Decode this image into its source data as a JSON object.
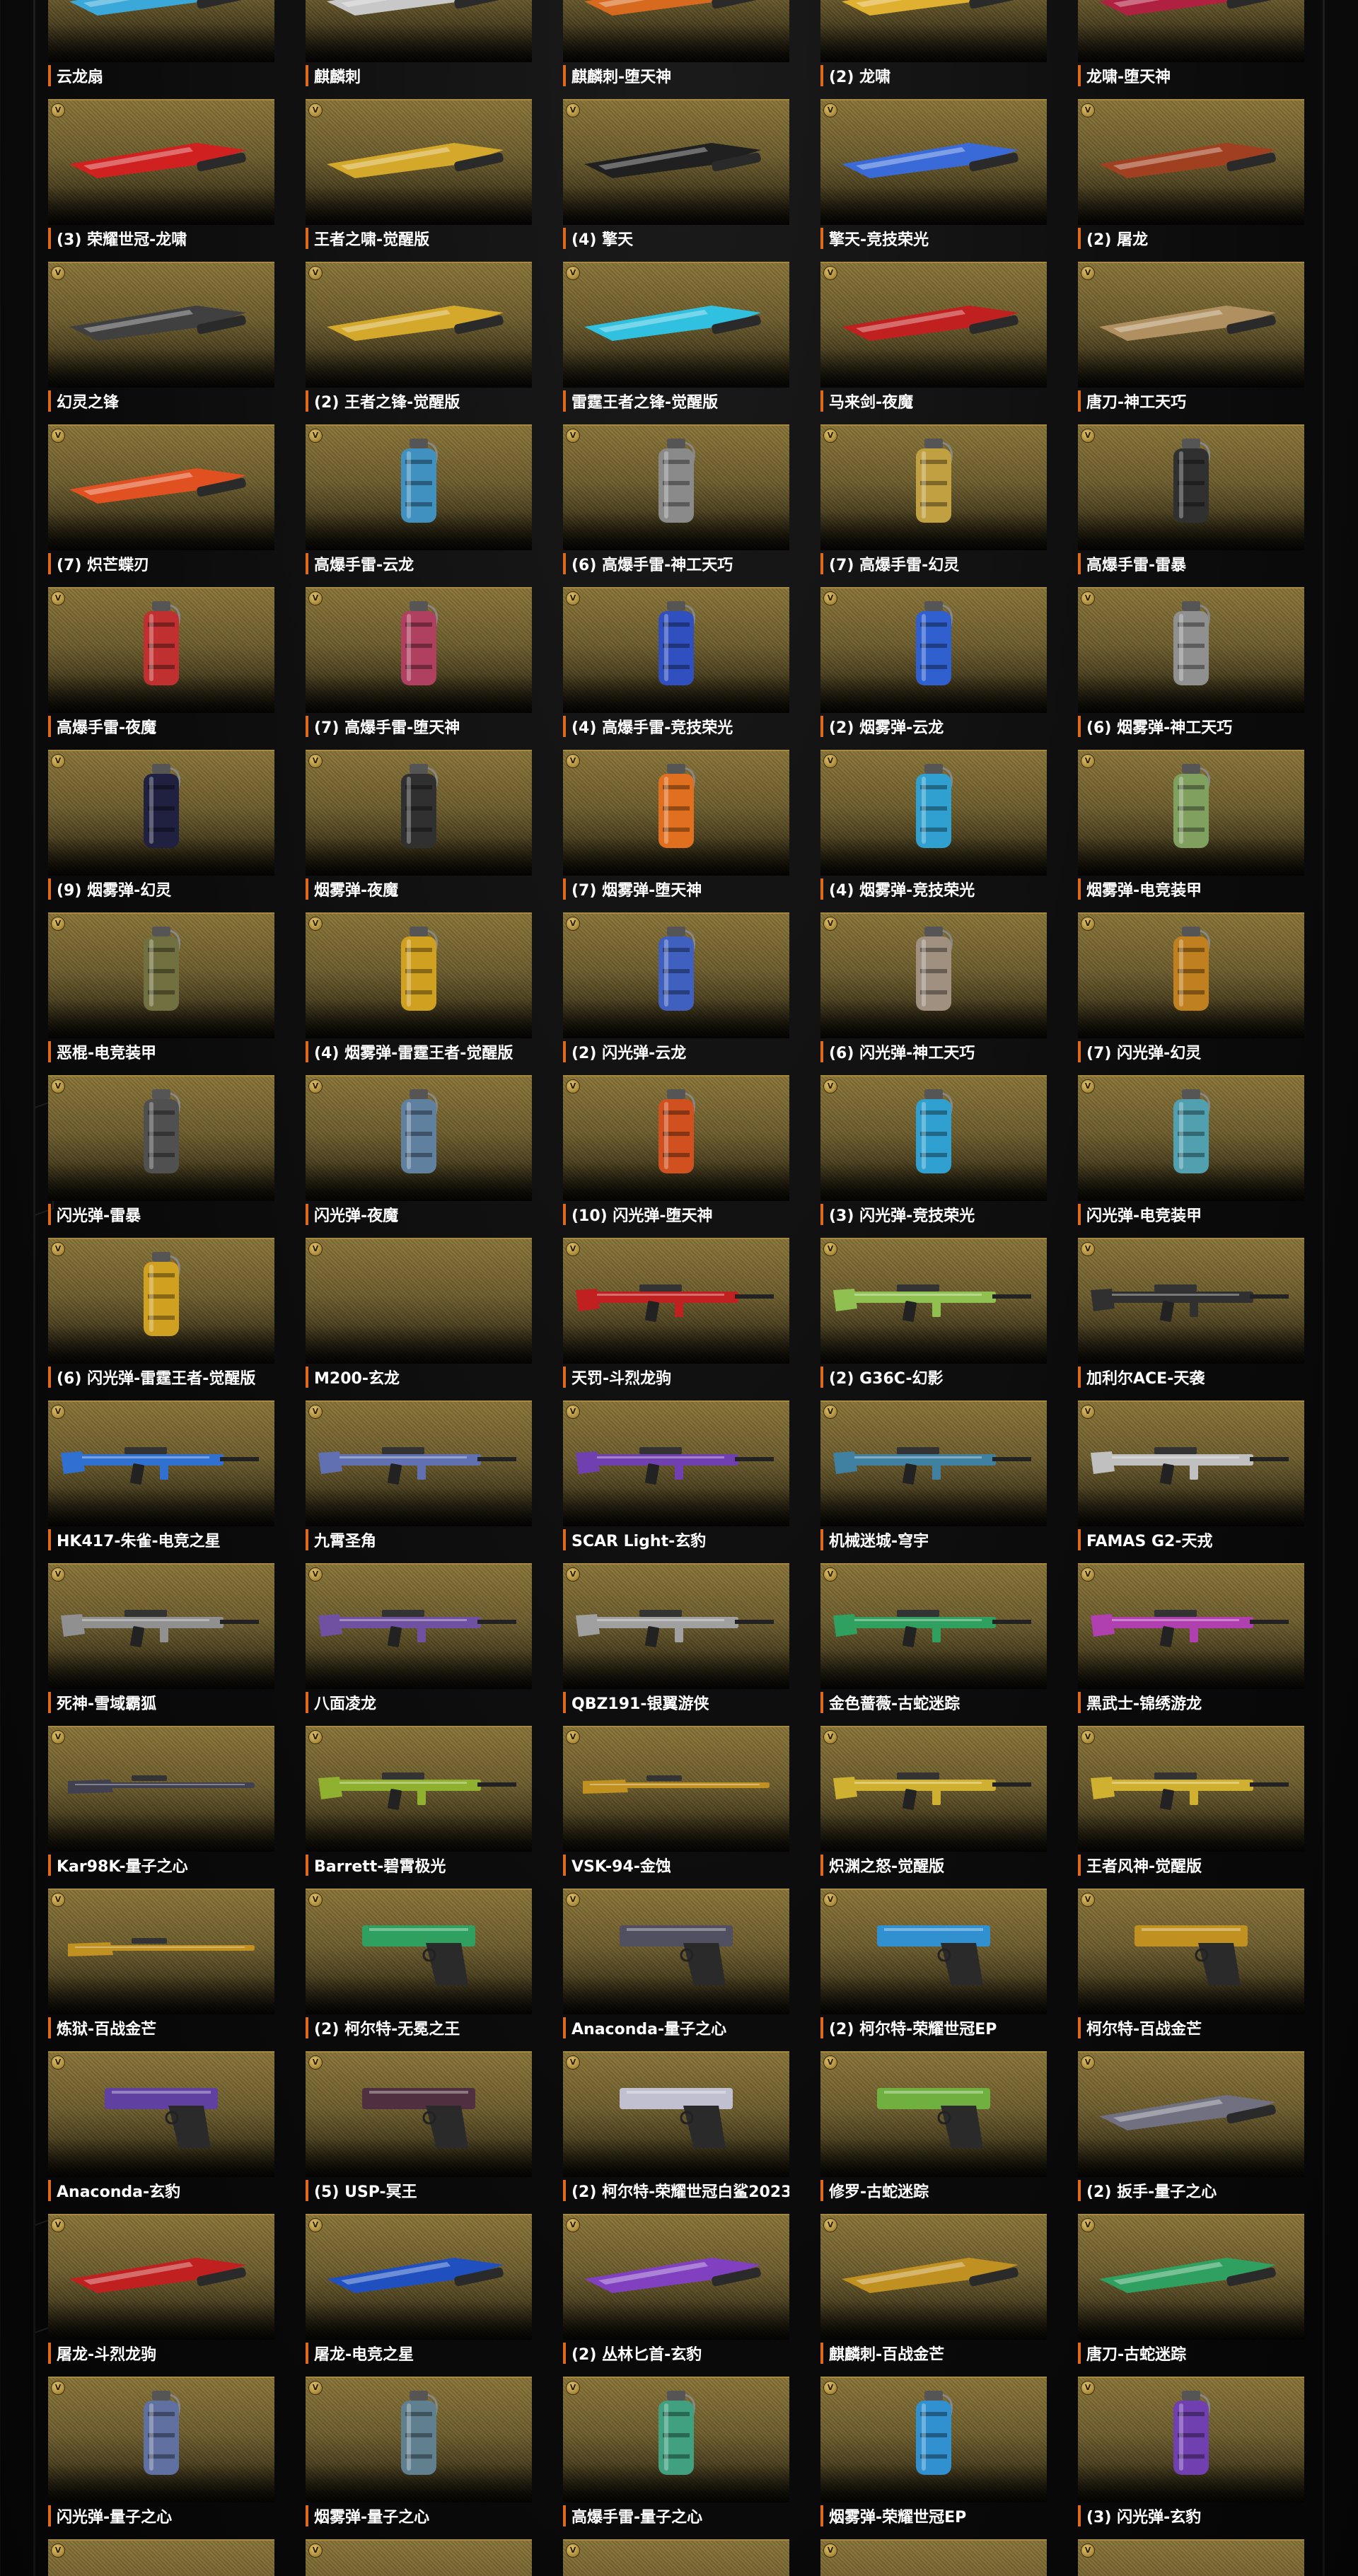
{
  "badge_letter": "V",
  "accent_color": "#e06a1a",
  "card_bg_color": "#8a7538",
  "items": [
    {
      "label": "云龙扇",
      "icon": "fan-icon",
      "kind": "melee",
      "color": "#3aa8d8"
    },
    {
      "label": "麒麟刺",
      "icon": "blade-icon",
      "kind": "melee",
      "color": "#c8c8c8"
    },
    {
      "label": "麒麟刺-堕天神",
      "icon": "blade-icon",
      "kind": "melee",
      "color": "#d86a20"
    },
    {
      "label": "(2) 龙啸",
      "icon": "axe-icon",
      "kind": "melee",
      "color": "#e0b030"
    },
    {
      "label": "龙啸-堕天神",
      "icon": "axe-icon",
      "kind": "melee",
      "color": "#b02040"
    },
    {
      "label": "(3) 荣耀世冠-龙啸",
      "icon": "axe-icon",
      "kind": "melee",
      "color": "#d02020"
    },
    {
      "label": "王者之啸-觉醒版",
      "icon": "axe-icon",
      "kind": "melee",
      "color": "#d4a82a"
    },
    {
      "label": "(4) 擎天",
      "icon": "shovel-icon",
      "kind": "melee",
      "color": "#202020"
    },
    {
      "label": "擎天-竞技荣光",
      "icon": "shovel-icon",
      "kind": "melee",
      "color": "#3a6ad8"
    },
    {
      "label": "(2) 屠龙",
      "icon": "machete-icon",
      "kind": "melee",
      "color": "#a04020"
    },
    {
      "label": "幻灵之锋",
      "icon": "knife-icon",
      "kind": "melee",
      "color": "#404040"
    },
    {
      "label": "(2) 王者之锋-觉醒版",
      "icon": "knife-icon",
      "kind": "melee",
      "color": "#d4a82a"
    },
    {
      "label": "雷霆王者之锋-觉醒版",
      "icon": "knife-icon",
      "kind": "melee",
      "color": "#30c0e0"
    },
    {
      "label": "马来剑-夜魔",
      "icon": "sword-icon",
      "kind": "melee",
      "color": "#c02020"
    },
    {
      "label": "唐刀-神工天巧",
      "icon": "sword-icon",
      "kind": "melee",
      "color": "#b09060"
    },
    {
      "label": "(7) 炽芒蝶刃",
      "icon": "butterfly-knife-icon",
      "kind": "melee",
      "color": "#e05020"
    },
    {
      "label": "高爆手雷-云龙",
      "icon": "grenade-icon",
      "kind": "grenade",
      "color": "#4090c0"
    },
    {
      "label": "(6) 高爆手雷-神工天巧",
      "icon": "grenade-icon",
      "kind": "grenade",
      "color": "#8a8a8a"
    },
    {
      "label": "(7) 高爆手雷-幻灵",
      "icon": "grenade-icon",
      "kind": "grenade",
      "color": "#c0a040"
    },
    {
      "label": "高爆手雷-雷暴",
      "icon": "grenade-icon",
      "kind": "grenade",
      "color": "#303030"
    },
    {
      "label": "高爆手雷-夜魔",
      "icon": "grenade-icon",
      "kind": "grenade",
      "color": "#c03030"
    },
    {
      "label": "(7) 高爆手雷-堕天神",
      "icon": "grenade-icon",
      "kind": "grenade",
      "color": "#b04060"
    },
    {
      "label": "(4) 高爆手雷-竞技荣光",
      "icon": "grenade-icon",
      "kind": "grenade",
      "color": "#3050c0"
    },
    {
      "label": "(2) 烟雾弹-云龙",
      "icon": "smoke-grenade-icon",
      "kind": "grenade",
      "color": "#3060d0"
    },
    {
      "label": "(6) 烟雾弹-神工天巧",
      "icon": "smoke-grenade-icon",
      "kind": "grenade",
      "color": "#909090"
    },
    {
      "label": "(9) 烟雾弹-幻灵",
      "icon": "smoke-grenade-icon",
      "kind": "grenade",
      "color": "#202040"
    },
    {
      "label": "烟雾弹-夜魔",
      "icon": "smoke-grenade-icon",
      "kind": "grenade",
      "color": "#303030"
    },
    {
      "label": "(7) 烟雾弹-堕天神",
      "icon": "smoke-grenade-icon",
      "kind": "grenade",
      "color": "#e07020"
    },
    {
      "label": "(4) 烟雾弹-竞技荣光",
      "icon": "smoke-grenade-icon",
      "kind": "grenade",
      "color": "#30a0d0"
    },
    {
      "label": "烟雾弹-电竞装甲",
      "icon": "smoke-grenade-icon",
      "kind": "grenade",
      "color": "#80a060"
    },
    {
      "label": "恶棍-电竞装甲",
      "icon": "grenade-icon",
      "kind": "grenade",
      "color": "#707040"
    },
    {
      "label": "(4) 烟雾弹-雷霆王者-觉醒版",
      "icon": "smoke-grenade-icon",
      "kind": "grenade",
      "color": "#d0a020"
    },
    {
      "label": "(2) 闪光弹-云龙",
      "icon": "flashbang-icon",
      "kind": "grenade",
      "color": "#4060c0"
    },
    {
      "label": "(6) 闪光弹-神工天巧",
      "icon": "flashbang-icon",
      "kind": "grenade",
      "color": "#a09080"
    },
    {
      "label": "(7) 闪光弹-幻灵",
      "icon": "flashbang-icon",
      "kind": "grenade",
      "color": "#c08020"
    },
    {
      "label": "闪光弹-雷暴",
      "icon": "flashbang-icon",
      "kind": "grenade",
      "color": "#505050"
    },
    {
      "label": "闪光弹-夜魔",
      "icon": "flashbang-icon",
      "kind": "grenade",
      "color": "#6080a0"
    },
    {
      "label": "(10) 闪光弹-堕天神",
      "icon": "flashbang-icon",
      "kind": "grenade",
      "color": "#d05020"
    },
    {
      "label": "(3) 闪光弹-竞技荣光",
      "icon": "flashbang-icon",
      "kind": "grenade",
      "color": "#30a0d0"
    },
    {
      "label": "闪光弹-电竞装甲",
      "icon": "flashbang-icon",
      "kind": "grenade",
      "color": "#50a0b0"
    },
    {
      "label": "(6) 闪光弹-雷霆王者-觉醒版",
      "icon": "flashbang-icon",
      "kind": "grenade",
      "color": "#d0a020"
    },
    {
      "label": "M200-玄龙",
      "icon": "sniper-rifle-icon",
      "kind": "none",
      "color": "#202020"
    },
    {
      "label": "天罚-斗烈龙驹",
      "icon": "rifle-icon",
      "kind": "rifle",
      "color": "#c02020"
    },
    {
      "label": "(2) G36C-幻影",
      "icon": "rifle-icon",
      "kind": "rifle",
      "color": "#90c050"
    },
    {
      "label": "加利尔ACE-天袭",
      "icon": "rifle-icon",
      "kind": "rifle",
      "color": "#303030"
    },
    {
      "label": "HK417-朱雀-电竞之星",
      "icon": "rifle-icon",
      "kind": "rifle",
      "color": "#3070d0"
    },
    {
      "label": "九霄圣角",
      "icon": "rifle-icon",
      "kind": "rifle",
      "color": "#6070b0"
    },
    {
      "label": "SCAR Light-玄豹",
      "icon": "rifle-icon",
      "kind": "rifle",
      "color": "#7040b0"
    },
    {
      "label": "机械迷城-穹宇",
      "icon": "rifle-icon",
      "kind": "rifle",
      "color": "#4080a0"
    },
    {
      "label": "FAMAS G2-天戎",
      "icon": "rifle-icon",
      "kind": "rifle",
      "color": "#c0c0c0"
    },
    {
      "label": "死神-雪域霸狐",
      "icon": "rifle-icon",
      "kind": "rifle",
      "color": "#909090"
    },
    {
      "label": "八面凌龙",
      "icon": "rifle-icon",
      "kind": "rifle",
      "color": "#7050a0"
    },
    {
      "label": "QBZ191-银翼游侠",
      "icon": "rifle-icon",
      "kind": "rifle",
      "color": "#a0a0a0"
    },
    {
      "label": "金色蔷薇-古蛇迷踪",
      "icon": "rifle-icon",
      "kind": "rifle",
      "color": "#30a060"
    },
    {
      "label": "黑武士-锦绣游龙",
      "icon": "rifle-icon",
      "kind": "rifle",
      "color": "#b040b0"
    },
    {
      "label": "Kar98K-量子之心",
      "icon": "sniper-rifle-icon",
      "kind": "long",
      "color": "#404050"
    },
    {
      "label": "Barrett-碧霄极光",
      "icon": "sniper-rifle-icon",
      "kind": "rifle",
      "color": "#90b030"
    },
    {
      "label": "VSK-94-金蚀",
      "icon": "sniper-rifle-icon",
      "kind": "long",
      "color": "#c09020"
    },
    {
      "label": "炽渊之怒-觉醒版",
      "icon": "rifle-icon",
      "kind": "rifle",
      "color": "#d0b030"
    },
    {
      "label": "王者风神-觉醒版",
      "icon": "rifle-icon",
      "kind": "rifle",
      "color": "#d0b030"
    },
    {
      "label": "炼狱-百战金芒",
      "icon": "rifle-icon",
      "kind": "long",
      "color": "#c09020"
    },
    {
      "label": "(2) 柯尔特-无冕之王",
      "icon": "pistol-icon",
      "kind": "pistol",
      "color": "#30a060"
    },
    {
      "label": "Anaconda-量子之心",
      "icon": "revolver-icon",
      "kind": "pistol",
      "color": "#505060"
    },
    {
      "label": "(2) 柯尔特-荣耀世冠EP",
      "icon": "pistol-icon",
      "kind": "pistol",
      "color": "#3090d0"
    },
    {
      "label": "柯尔特-百战金芒",
      "icon": "pistol-icon",
      "kind": "pistol",
      "color": "#c09020"
    },
    {
      "label": "Anaconda-玄豹",
      "icon": "revolver-icon",
      "kind": "pistol",
      "color": "#6040a0"
    },
    {
      "label": "(5) USP-冥王",
      "icon": "pistol-icon",
      "kind": "pistol",
      "color": "#503040"
    },
    {
      "label": "(2) 柯尔特-荣耀世冠白鲨2023",
      "icon": "pistol-icon",
      "kind": "pistol",
      "color": "#c0c0d0"
    },
    {
      "label": "修罗-古蛇迷踪",
      "icon": "pistol-icon",
      "kind": "pistol",
      "color": "#70b040"
    },
    {
      "label": "(2) 扳手-量子之心",
      "icon": "wrench-icon",
      "kind": "melee",
      "color": "#707080"
    },
    {
      "label": "屠龙-斗烈龙驹",
      "icon": "machete-icon",
      "kind": "melee",
      "color": "#c02020"
    },
    {
      "label": "屠龙-电竞之星",
      "icon": "machete-icon",
      "kind": "melee",
      "color": "#2050c0"
    },
    {
      "label": "(2) 丛林匕首-玄豹",
      "icon": "knife-icon",
      "kind": "melee",
      "color": "#8040c0"
    },
    {
      "label": "麒麟刺-百战金芒",
      "icon": "blade-icon",
      "kind": "melee",
      "color": "#c09020"
    },
    {
      "label": "唐刀-古蛇迷踪",
      "icon": "sword-icon",
      "kind": "melee",
      "color": "#30a060"
    },
    {
      "label": "闪光弹-量子之心",
      "icon": "flashbang-icon",
      "kind": "grenade",
      "color": "#6070a0"
    },
    {
      "label": "烟雾弹-量子之心",
      "icon": "smoke-grenade-icon",
      "kind": "grenade",
      "color": "#608090"
    },
    {
      "label": "高爆手雷-量子之心",
      "icon": "grenade-icon",
      "kind": "grenade",
      "color": "#40a080"
    },
    {
      "label": "烟雾弹-荣耀世冠EP",
      "icon": "smoke-grenade-icon",
      "kind": "grenade",
      "color": "#3090d0"
    },
    {
      "label": "(3) 闪光弹-玄豹",
      "icon": "flashbang-icon",
      "kind": "grenade",
      "color": "#7040b0"
    },
    {
      "label": "",
      "icon": "weapon-icon",
      "kind": "melee",
      "color": "#808080"
    },
    {
      "label": "",
      "icon": "weapon-icon",
      "kind": "melee",
      "color": "#808080"
    },
    {
      "label": "",
      "icon": "weapon-icon",
      "kind": "melee",
      "color": "#c09020"
    },
    {
      "label": "",
      "icon": "weapon-icon",
      "kind": "melee",
      "color": "#c09020"
    },
    {
      "label": "",
      "icon": "weapon-icon",
      "kind": "melee",
      "color": "#808080"
    }
  ]
}
